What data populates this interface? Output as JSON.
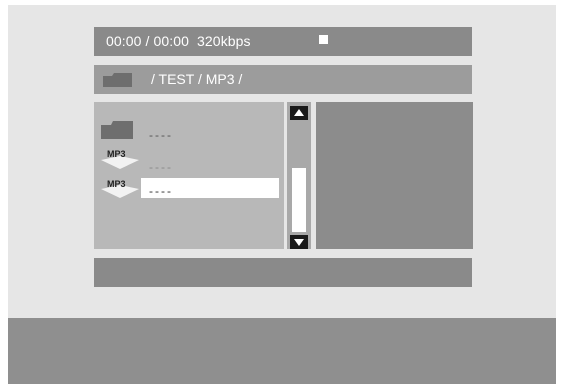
{
  "status": {
    "time": "00:00 / 00:00",
    "bitrate": "320kbps",
    "stop_icon": "stop-icon"
  },
  "path": {
    "folder_icon": "folder-icon",
    "text": "/ TEST /  MP3 /"
  },
  "file_list": {
    "items": [
      {
        "type": "folder",
        "icon": "folder-icon",
        "label": "",
        "name": "----"
      },
      {
        "type": "mp3",
        "icon": "mp3-file-icon",
        "label": "MP3",
        "name": "----"
      },
      {
        "type": "mp3",
        "icon": "mp3-file-icon",
        "label": "MP3",
        "name": "----",
        "selected": true
      }
    ]
  },
  "scrollbar": {
    "up_icon": "arrow-up-icon",
    "down_icon": "arrow-down-icon"
  },
  "colors": {
    "screen_bg": "#e6e6e6",
    "bar_bg": "#8a8a8a",
    "list_bg": "#b8b8b8",
    "highlight": "#ffffff",
    "bottom_bar": "#8f8f8f"
  }
}
